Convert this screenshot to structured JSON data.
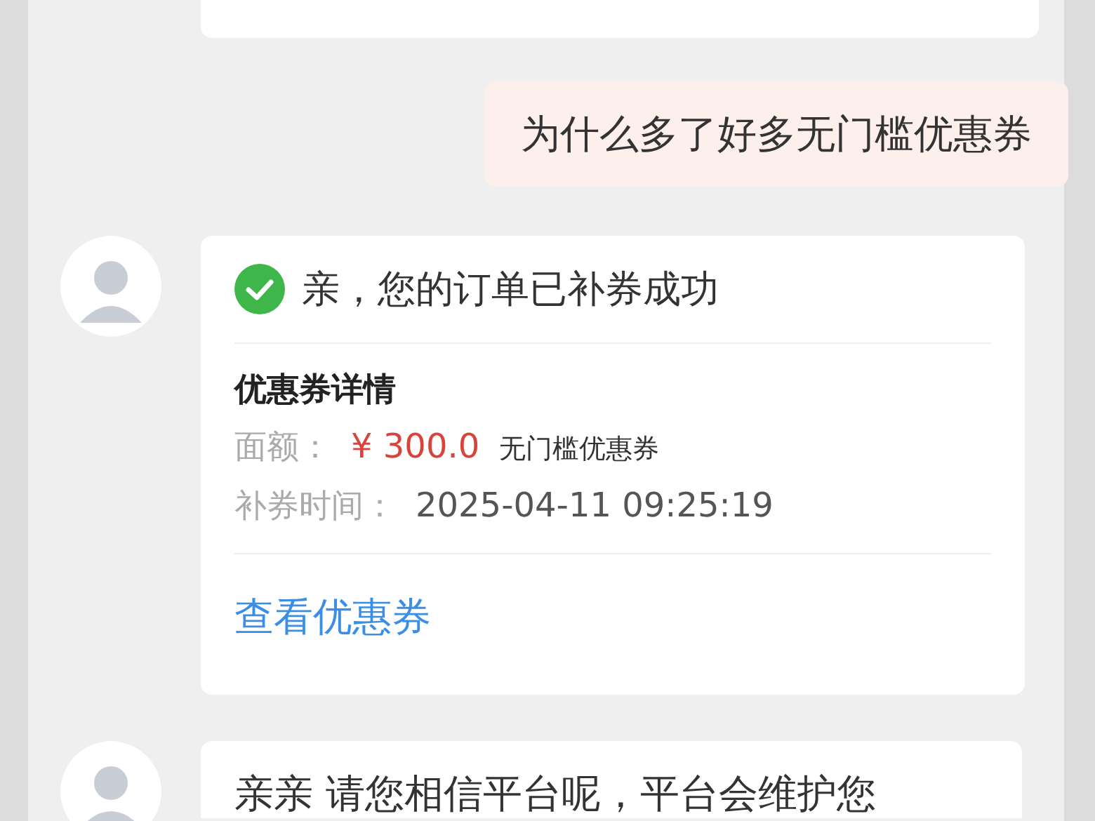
{
  "messages": [
    {
      "kind": "partial"
    },
    {
      "kind": "sent",
      "text": "为什么多了好多无门槛优惠券"
    },
    {
      "kind": "card",
      "title": "亲，您的订单已补券成功",
      "section": "优惠券详情",
      "rows": [
        {
          "kind": "amount",
          "label": "面额：",
          "value": "¥ 300.0",
          "note": "无门槛优惠券"
        },
        {
          "kind": "time",
          "label": "补券时间：",
          "value": "2025-04-11 09:25:19"
        }
      ],
      "link": "查看优惠券"
    },
    {
      "kind": "received",
      "text": "亲亲 请您相信平台呢，平台会维护您"
    }
  ]
}
